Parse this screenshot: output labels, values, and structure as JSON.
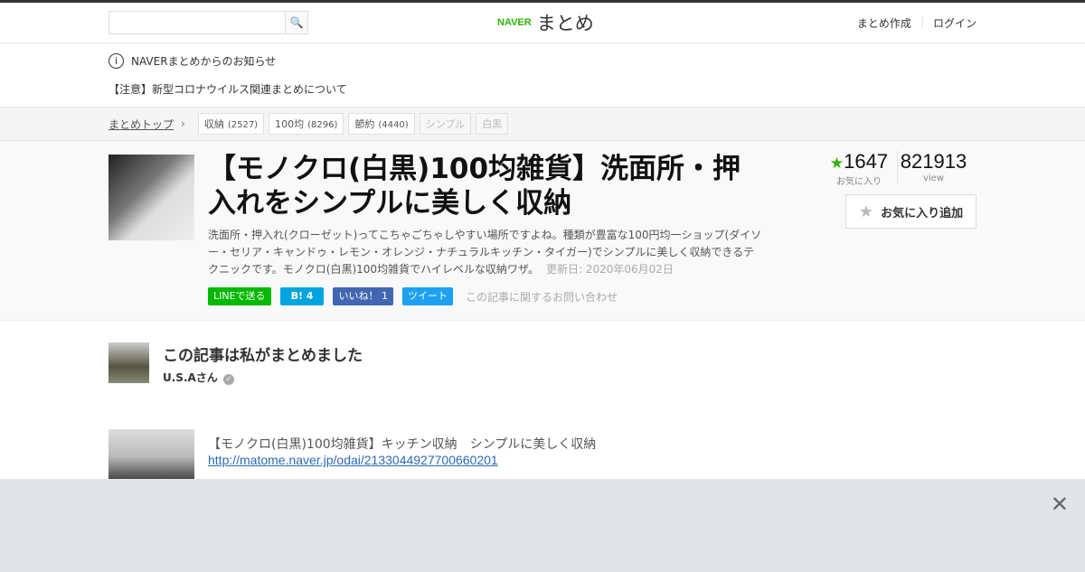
{
  "header": {
    "search_placeholder": "",
    "search_icon": "magnifier-icon",
    "logo_naver": "NAVER",
    "logo_matome": "まとめ",
    "create": "まとめ作成",
    "login": "ログイン"
  },
  "notice": {
    "title": "NAVERまとめからのお知らせ",
    "item": "【注意】新型コロナウイルス関連まとめについて"
  },
  "breadcrumb": {
    "top": "まとめトップ",
    "tags": [
      {
        "label": "収納",
        "count": "(2527)"
      },
      {
        "label": "100均",
        "count": "(8296)"
      },
      {
        "label": "節約",
        "count": "(4440)"
      },
      {
        "label": "シンプル"
      },
      {
        "label": "白黒"
      }
    ]
  },
  "article": {
    "title": "【モノクロ(白黒)100均雑貨】洗面所・押入れをシンプルに美しく収納",
    "description": "洗面所・押入れ(クローゼット)ってこちゃごちゃしやすい場所ですよね。種類が豊富な100円均一ショップ(ダイソー・セリア・キャンドゥ・レモン・オレンジ・ナチュラルキッチン・タイガー)でシンプルに美しく収納できるテクニックです。モノクロ(白黒)100均雑貨でハイレベルな収納ワザ。",
    "updated": "更新日: 2020年06月02日",
    "share": {
      "line": "LINEで送る",
      "hatena": "B! 4",
      "facebook": "いいね！ 1",
      "twitter": "ツイート",
      "inquiry": "この記事に関するお問い合わせ"
    },
    "favorites": "1647",
    "favorites_label": "お気に入り",
    "views": "821913",
    "views_label": "view",
    "add_favorite": "お気に入り追加",
    "accent": "#2db400"
  },
  "author": {
    "heading": "この記事は私がまとめました",
    "name": "U.S.Aさん"
  },
  "related": {
    "title": "【モノクロ(白黒)100均雑貨】キッチン収納　シンプルに美しく収納",
    "url": "http://matome.naver.jp/odai/2133044927700660201"
  },
  "ad": {
    "close": "✕"
  }
}
